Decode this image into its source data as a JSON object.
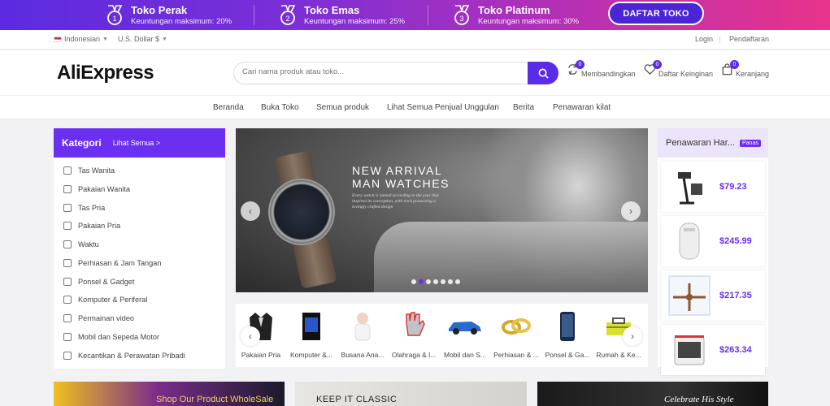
{
  "promo": {
    "tiers": [
      {
        "title": "Toko Perak",
        "subtitle": "Keuntungan maksimum: 20%",
        "number": "1"
      },
      {
        "title": "Toko Emas",
        "subtitle": "Keuntungan maksimum: 25%",
        "number": "2"
      },
      {
        "title": "Toko Platinum",
        "subtitle": "Keuntungan maksimum: 30%",
        "number": "3"
      }
    ],
    "cta": "DAFTAR TOKO"
  },
  "topbar": {
    "language": "Indonesian",
    "currency": "U.S. Dollar $",
    "login": "Login",
    "register": "Pendaftaran"
  },
  "header": {
    "logo": "AliExpress",
    "search_placeholder": "Cari nama produk atau toko...",
    "compare": {
      "label": "Membandingkan",
      "count": "0"
    },
    "wishlist": {
      "label": "Daftar Keinginan",
      "count": "0"
    },
    "cart": {
      "label": "Keranjang",
      "count": "0"
    }
  },
  "nav": [
    "Beranda",
    "Buka Toko",
    "Semua produk",
    "Lihat Semua Penjual Unggulan",
    "Berita",
    "Penawaran kilat"
  ],
  "categories": {
    "title": "Kategori",
    "see_all": "Lihat Semua >",
    "items": [
      "Tas Wanita",
      "Pakaian Wanita",
      "Tas Pria",
      "Pakaian Pria",
      "Waktu",
      "Perhiasan & Jam Tangan",
      "Ponsel & Gadget",
      "Komputer & Periferal",
      "Permainan video",
      "Mobil dan Sepeda Motor",
      "Kecantikan & Perawatan Pribadi"
    ]
  },
  "hero": {
    "line1": "NEW ARRIVAL",
    "line2": "MAN WATCHES",
    "blurb": "Every watch is named according to the year that inspired its conception, with each possessing a lovingly crafted design",
    "slide_count": 7,
    "active_slide": 2
  },
  "strip": [
    "Pakaian Pria",
    "Komputer &...",
    "Busana Ana...",
    "Olahraga & l...",
    "Mobil dan S...",
    "Perhiasan & ...",
    "Ponsel & Ga...",
    "Rumah & Ke..."
  ],
  "deals": {
    "title": "Penawaran Har...",
    "badge": "Panas",
    "items": [
      {
        "price": "$79.23"
      },
      {
        "price": "$245.99"
      },
      {
        "price": "$217.35"
      },
      {
        "price": "$263.34"
      }
    ]
  },
  "bottom_banners": {
    "b1": "Shop Our Product WholeSale",
    "b2": "KEEP IT CLASSIC",
    "b3": "Celebrate His Style"
  },
  "colors": {
    "accent": "#6a2ff0",
    "promo_start": "#5b2be0",
    "promo_end": "#e8338a"
  }
}
